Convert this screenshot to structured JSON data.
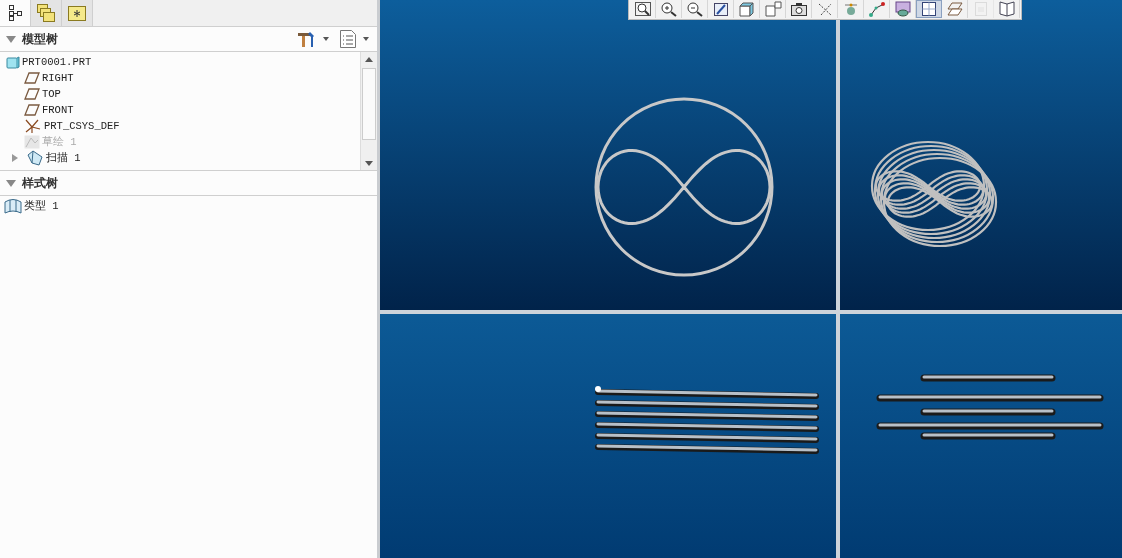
{
  "sidebar": {
    "tabs": [
      {
        "kind": "tree",
        "selected": true
      },
      {
        "kind": "folders",
        "selected": false
      },
      {
        "kind": "favorites",
        "selected": false
      }
    ],
    "model_tree": {
      "title": "模型树",
      "items": [
        {
          "kind": "part",
          "label": "PRT0001.PRT",
          "disabled": false
        },
        {
          "kind": "plane",
          "label": "RIGHT",
          "disabled": false
        },
        {
          "kind": "plane",
          "label": "TOP",
          "disabled": false
        },
        {
          "kind": "plane",
          "label": "FRONT",
          "disabled": false
        },
        {
          "kind": "csys",
          "label": "PRT_CSYS_DEF",
          "disabled": false
        },
        {
          "kind": "sketch",
          "label": "草绘 1",
          "disabled": true
        },
        {
          "kind": "sweep",
          "label": "扫描 1",
          "disabled": false,
          "expanded": false
        }
      ]
    },
    "style_tree": {
      "title": "样式树",
      "items": [
        {
          "kind": "style",
          "label": "类型 1"
        }
      ]
    }
  },
  "toolbar": {
    "buttons": [
      {
        "kind": "zoom-fit",
        "selected": false,
        "disabled": false
      },
      {
        "kind": "zoom-in",
        "selected": false,
        "disabled": false
      },
      {
        "kind": "zoom-out",
        "selected": false,
        "disabled": false
      },
      {
        "kind": "pencil",
        "selected": false,
        "disabled": false
      },
      {
        "kind": "cube",
        "selected": false,
        "disabled": false
      },
      {
        "kind": "view",
        "selected": false,
        "disabled": false
      },
      {
        "kind": "camera",
        "selected": false,
        "disabled": false
      },
      {
        "kind": "axis",
        "selected": false,
        "disabled": false
      },
      {
        "kind": "point",
        "selected": false,
        "disabled": false
      },
      {
        "kind": "node",
        "selected": false,
        "disabled": false
      },
      {
        "kind": "layers",
        "selected": false,
        "disabled": false
      },
      {
        "kind": "grid",
        "selected": true,
        "disabled": false
      },
      {
        "kind": "plane",
        "selected": false,
        "disabled": false
      },
      {
        "kind": "page",
        "selected": false,
        "disabled": true
      },
      {
        "kind": "book",
        "selected": false,
        "disabled": false
      }
    ]
  },
  "viewports": [
    {
      "kind": "front"
    },
    {
      "kind": "iso"
    },
    {
      "kind": "side"
    },
    {
      "kind": "top"
    }
  ]
}
